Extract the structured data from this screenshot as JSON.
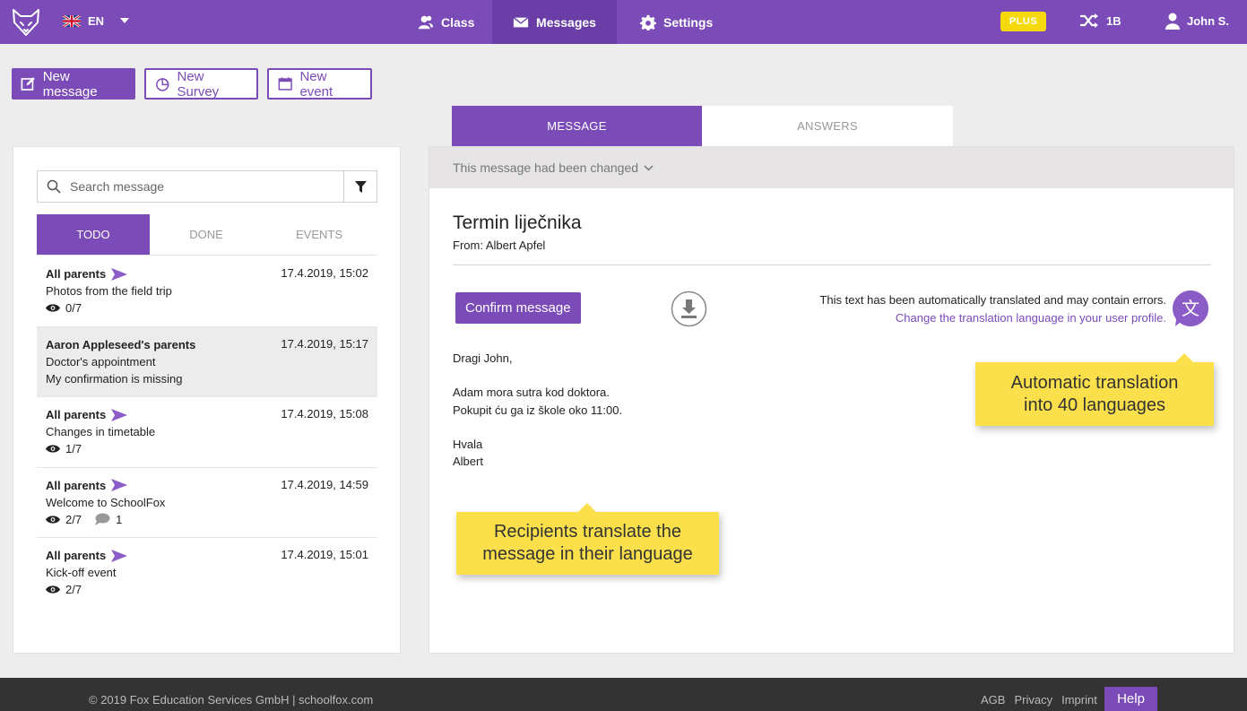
{
  "colors": {
    "primary": "#7b4bb8",
    "plus_badge": "#f5d90a",
    "callout": "#fbe04b"
  },
  "topbar": {
    "language": "EN",
    "nav": [
      {
        "label": "Class",
        "icon": "users-icon"
      },
      {
        "label": "Messages",
        "icon": "envelope-icon"
      },
      {
        "label": "Settings",
        "icon": "gear-icon"
      }
    ],
    "plus_label": "PLUS",
    "class_label": "1B",
    "user_label": "John S."
  },
  "actions": {
    "new_message": "New message",
    "new_survey": "New Survey",
    "new_event": "New event"
  },
  "left_panel": {
    "search_placeholder": "Search message",
    "tabs": [
      "TODO",
      "DONE",
      "EVENTS"
    ],
    "messages": [
      {
        "sender": "All parents",
        "date": "17.4.2019, 15:02",
        "subject": "Photos from the field trip",
        "views": "0/7"
      },
      {
        "sender": "Aaron Appleseed's parents",
        "date": "17.4.2019, 15:17",
        "subject": "Doctor's appointment",
        "note": "My confirmation is missing"
      },
      {
        "sender": "All parents",
        "date": "17.4.2019, 15:08",
        "subject": "Changes in timetable",
        "views": "1/7"
      },
      {
        "sender": "All parents",
        "date": "17.4.2019, 14:59",
        "subject": "Welcome to SchoolFox",
        "views": "2/7",
        "comments": "1"
      },
      {
        "sender": "All parents",
        "date": "17.4.2019, 15:01",
        "subject": "Kick-off event",
        "views": "2/7"
      }
    ]
  },
  "right_panel": {
    "tabs": [
      "MESSAGE",
      "ANSWERS"
    ],
    "changed_notice": "This message had been changed",
    "title": "Termin liječnika",
    "from": "From: Albert Apfel",
    "confirm_label": "Confirm message",
    "translation_note": "This text has been automatically translated and may contain errors.",
    "translation_link": "Change the translation language in your user profile.",
    "translate_glyph": "文",
    "body": {
      "greeting": "Dragi John,",
      "line1": "Adam mora sutra kod doktora.",
      "line2": "Pokupit ću ga iz škole oko 11:00.",
      "closing": "Hvala",
      "signature": "Albert"
    }
  },
  "callouts": {
    "translation": {
      "line1": "Automatic translation",
      "line2": "into 40 languages"
    },
    "recipients": {
      "line1": "Recipients translate the",
      "line2": "message in their language"
    }
  },
  "footer": {
    "copyright": "© 2019 Fox Education Services GmbH | schoolfox.com",
    "links": [
      "AGB",
      "Privacy",
      "Imprint"
    ],
    "help": "Help"
  }
}
